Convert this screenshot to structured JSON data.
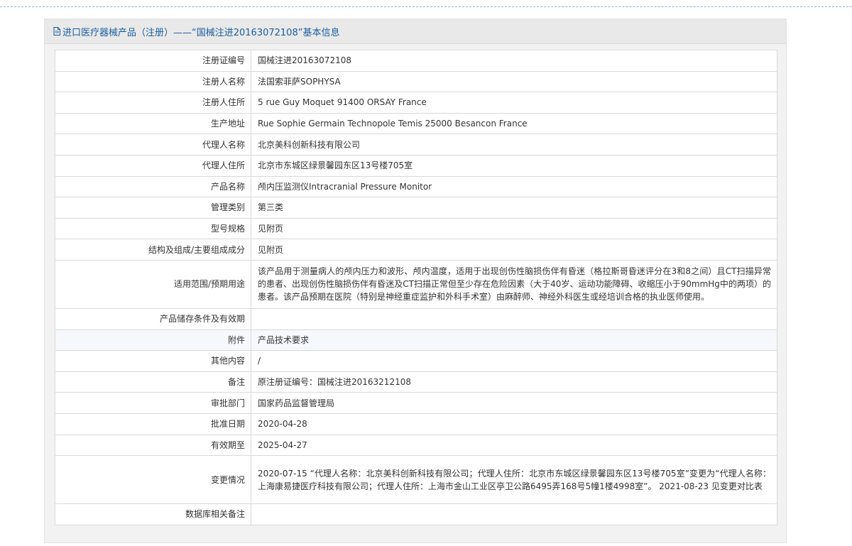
{
  "header": {
    "title": "进口医疗器械产品（注册）——“国械注进20163072108”基本信息"
  },
  "rows": [
    {
      "label": "注册证编号",
      "value": "国械注进20163072108"
    },
    {
      "label": "注册人名称",
      "value": "法国索菲萨SOPHYSA"
    },
    {
      "label": "注册人住所",
      "value": "5 rue Guy Moquet 91400 ORSAY France"
    },
    {
      "label": "生产地址",
      "value": "Rue Sophie Germain Technopole Temis 25000 Besancon France"
    },
    {
      "label": "代理人名称",
      "value": "北京美科创新科技有限公司"
    },
    {
      "label": "代理人住所",
      "value": "北京市东城区绿景馨园东区13号楼705室"
    },
    {
      "label": "产品名称",
      "value": "颅内压监测仪Intracranial Pressure Monitor"
    },
    {
      "label": "管理类别",
      "value": "第三类"
    },
    {
      "label": "型号规格",
      "value": "见附页"
    },
    {
      "label": "结构及组成/主要组成成分",
      "value": "见附页"
    },
    {
      "label": "适用范围/预期用途",
      "value": "该产品用于测量病人的颅内压力和波形、颅内温度，适用于出现创伤性脑损伤伴有昏迷（格拉斯哥昏迷评分在3和8之间）且CT扫描异常的患者、出现创伤性脑损伤伴有昏迷及CT扫描正常但至少存在危险因素（大于40岁、运动功能障碍、收缩压小于90mmHg中的两项）的患者。该产品预期在医院（特别是神经重症监护和外科手术室）由麻醉师、神经外科医生或经培训合格的执业医师使用。"
    },
    {
      "label": "产品储存条件及有效期",
      "value": ""
    },
    {
      "label": "附件",
      "value": "产品技术要求"
    },
    {
      "label": "其他内容",
      "value": "/"
    },
    {
      "label": "备注",
      "value": "原注册证编号：国械注进20163212108"
    },
    {
      "label": "审批部门",
      "value": "国家药品监督管理局"
    },
    {
      "label": "批准日期",
      "value": "2020-04-28"
    },
    {
      "label": "有效期至",
      "value": "2025-04-27"
    },
    {
      "label": "变更情况",
      "value": "2020-07-15 “代理人名称：北京美科创新科技有限公司；代理人住所：北京市东城区绿景馨园东区13号楼705室”变更为“代理人名称：上海康易捷医疗科技有限公司；代理人住所：上海市金山工业区亭卫公路6495弄168号5幢1楼4998室”。 2021-08-23 见变更对比表"
    },
    {
      "label": "数据库相关备注",
      "value": ""
    }
  ]
}
